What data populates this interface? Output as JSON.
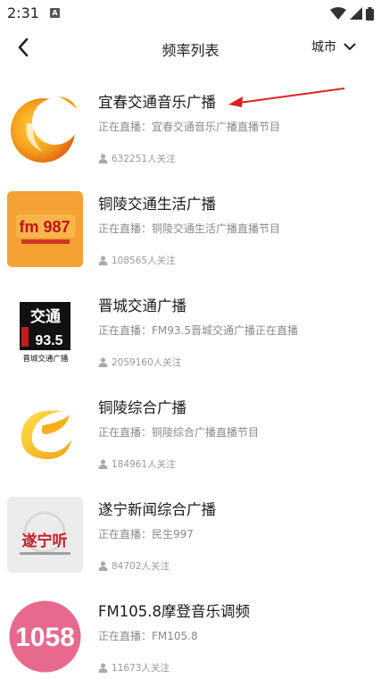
{
  "status": {
    "time": "2:31",
    "notification_badge": "A"
  },
  "nav": {
    "title": "频率列表",
    "city_label": "城市"
  },
  "stations": [
    {
      "name": "宜春交通音乐广播",
      "live": "正在直播：宜春交通音乐广播直播节目",
      "followers": "632251人关注"
    },
    {
      "name": "铜陵交通生活广播",
      "live": "正在直播：铜陵交通生活广播直播节目",
      "followers": "108565人关注"
    },
    {
      "name": "晋城交通广播",
      "live": "正在直播：FM93.5晋城交通广播正在直播",
      "followers": "2059160人关注"
    },
    {
      "name": "铜陵综合广播",
      "live": "正在直播：铜陵综合广播直播节目",
      "followers": "184961人关注"
    },
    {
      "name": "遂宁新闻综合广播",
      "live": "正在直播：民生997",
      "followers": "84702人关注"
    },
    {
      "name": "FM105.8摩登音乐调频",
      "live": "正在直播：FM105.8",
      "followers": "11673人关注"
    }
  ],
  "logo_text": {
    "tongling_fm": "fm 987",
    "jincheng_top": "交通",
    "jincheng_freq": "93.5",
    "jincheng_bottom": "晋城交通广播",
    "suining": "遂宁听",
    "fm1058": "1058"
  },
  "icons": {
    "back": "chevron-left-icon",
    "city_dropdown": "chevron-down-icon",
    "follower": "person-icon"
  },
  "colors": {
    "annotation_arrow": "#e02020",
    "fm1058_bg": "#e76a8e",
    "tongling_bg": "#f4a234"
  }
}
